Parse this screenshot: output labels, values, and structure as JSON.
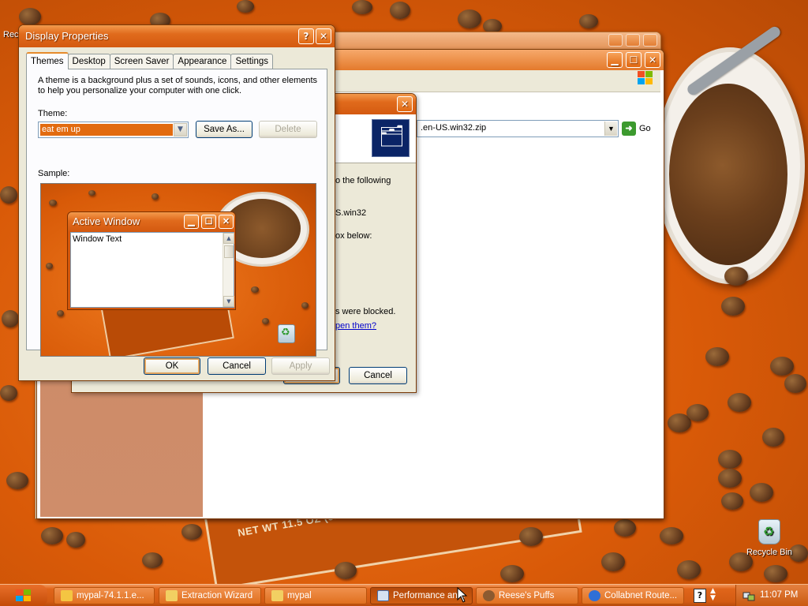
{
  "desktop": {
    "recycle_bin_label": "Recycle Bin",
    "partial_icon_label": "Rec",
    "box_text": "NET WT 11.5 OZ (326g)"
  },
  "wizard": {
    "close_glyph": "✕",
    "text_following": "o the following",
    "text_win32": "S.win32",
    "text_box_below": "ox below:",
    "text_blocked": "s were blocked.",
    "text_link": "pen them?",
    "cancel_label": "Cancel"
  },
  "address": {
    "value": ".en-US.win32.zip",
    "go_label": "Go"
  },
  "display_properties": {
    "title": "Display Properties",
    "help_glyph": "?",
    "close_glyph": "✕",
    "tabs": [
      {
        "label": "Themes",
        "active": true
      },
      {
        "label": "Desktop",
        "active": false
      },
      {
        "label": "Screen Saver",
        "active": false
      },
      {
        "label": "Appearance",
        "active": false
      },
      {
        "label": "Settings",
        "active": false
      }
    ],
    "description": "A theme is a background plus a set of sounds, icons, and other elements to help you personalize your computer with one click.",
    "theme_label": "Theme:",
    "theme_value": "eat em up",
    "save_as_label": "Save As...",
    "delete_label": "Delete",
    "sample_label": "Sample:",
    "sample": {
      "active_window_title": "Active Window",
      "window_text": "Window Text"
    },
    "ok_label": "OK",
    "cancel_label": "Cancel",
    "apply_label": "Apply"
  },
  "taskbar": {
    "tasks": [
      {
        "label": "mypal-74.1.1.e...",
        "active": false
      },
      {
        "label": "Extraction Wizard",
        "active": false
      },
      {
        "label": "mypal",
        "active": false
      },
      {
        "label": "Performance an...",
        "active": true
      },
      {
        "label": "Reese's Puffs",
        "active": false
      },
      {
        "label": "Collabnet Route...",
        "active": false
      }
    ],
    "clock": "11:07 PM"
  },
  "colors": {
    "accent": "#e06a1c",
    "title_bar": "#d45a10",
    "selection": "#e26b10"
  }
}
